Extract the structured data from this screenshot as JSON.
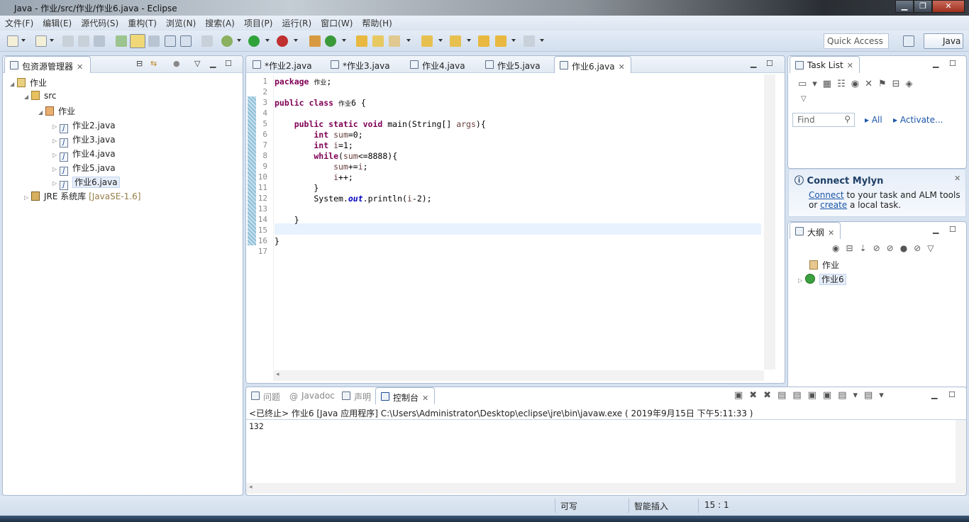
{
  "window": {
    "title": "Java  -  作业/src/作业/作业6.java  -  Eclipse",
    "min": "▁",
    "max": "❐",
    "close": "✕"
  },
  "menu": [
    "文件(F)",
    "编辑(E)",
    "源代码(S)",
    "重构(T)",
    "浏览(N)",
    "搜索(A)",
    "项目(P)",
    "运行(R)",
    "窗口(W)",
    "帮助(H)"
  ],
  "toolbar": {
    "quick_access": "Quick Access",
    "perspective": "Java"
  },
  "explorer": {
    "tab": "包资源管理器",
    "root": "作业",
    "src": "src",
    "package": "作业",
    "files": [
      "作业2.java",
      "作业3.java",
      "作业4.java",
      "作业5.java",
      "作业6.java"
    ],
    "jre": "JRE 系统库",
    "jre_version": "[JavaSE-1.6]"
  },
  "editor": {
    "tabs": [
      {
        "label": "*作业2.java"
      },
      {
        "label": "*作业3.java"
      },
      {
        "label": "作业4.java"
      },
      {
        "label": "作业5.java"
      },
      {
        "label": "作业6.java",
        "active": true
      }
    ],
    "lines": [
      [
        [
          "package ",
          "kw"
        ],
        [
          "作业",
          "cn"
        ],
        [
          ";",
          ""
        ]
      ],
      [],
      [
        [
          "public class ",
          "kw"
        ],
        [
          "作业",
          "cn"
        ],
        [
          "6 {",
          ""
        ]
      ],
      [],
      [
        [
          "    public static void ",
          "kw"
        ],
        [
          "main(String[] ",
          ""
        ],
        [
          "args",
          "var"
        ],
        [
          "){",
          ""
        ]
      ],
      [
        [
          "        int ",
          "kw"
        ],
        [
          "sum",
          "var"
        ],
        [
          "=0;",
          ""
        ]
      ],
      [
        [
          "        int ",
          "kw"
        ],
        [
          "i",
          "var"
        ],
        [
          "=1;",
          ""
        ]
      ],
      [
        [
          "        while",
          "kw"
        ],
        [
          "(",
          ""
        ],
        [
          "sum",
          "var"
        ],
        [
          "<=8888){",
          ""
        ]
      ],
      [
        [
          "            sum",
          "var"
        ],
        [
          "+=",
          ""
        ],
        [
          "i",
          "var"
        ],
        [
          ";",
          ""
        ]
      ],
      [
        [
          "            i",
          "var"
        ],
        [
          "++;",
          ""
        ]
      ],
      [
        [
          "        }",
          ""
        ]
      ],
      [
        [
          "        System.",
          ""
        ],
        [
          "out",
          "fld"
        ],
        [
          ".println(",
          ""
        ],
        [
          "i",
          "var"
        ],
        [
          "-2);",
          ""
        ]
      ],
      [],
      [
        [
          "    }",
          ""
        ]
      ],
      [],
      [
        [
          "}",
          ""
        ]
      ],
      []
    ]
  },
  "tasklist": {
    "tab": "Task List",
    "find_placeholder": "Find",
    "all": "All",
    "activate": "Activate..."
  },
  "mylyn": {
    "title": "Connect Mylyn",
    "connect": "Connect",
    "text1": " to your task and ALM tools",
    "or": "or ",
    "create": "create",
    "text2": " a local task."
  },
  "outline": {
    "tab": "大纲",
    "items": [
      "作业",
      "作业6"
    ]
  },
  "console": {
    "tabs": [
      "问题",
      "Javadoc",
      "声明",
      "控制台"
    ],
    "header": "<已终止> 作业6 [Java 应用程序] C:\\Users\\Administrator\\Desktop\\eclipse\\jre\\bin\\javaw.exe ( 2019年9月15日 下午5:11:33 )",
    "output": "132"
  },
  "status": {
    "writable": "可写",
    "insert_mode": "智能插入",
    "position": "15 : 1"
  }
}
